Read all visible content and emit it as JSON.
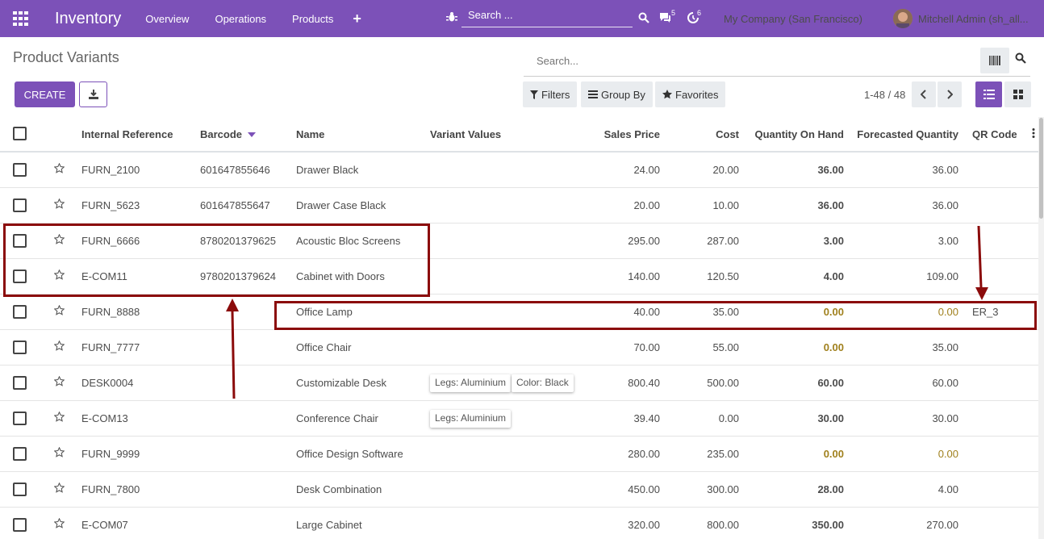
{
  "navbar": {
    "app_title": "Inventory",
    "menu": [
      "Overview",
      "Operations",
      "Products"
    ],
    "plus": "+",
    "search_placeholder": "Search ...",
    "chat_count": "5",
    "activity_count": "6",
    "company": "My Company (San Francisco)",
    "user": "Mitchell Admin (sh_all..."
  },
  "control": {
    "breadcrumb": "Product Variants",
    "search_placeholder": "Search...",
    "create": "CREATE",
    "filters": "Filters",
    "group_by": "Group By",
    "favorites": "Favorites",
    "pager": "1-48 / 48"
  },
  "table": {
    "headers": {
      "internal_ref": "Internal Reference",
      "barcode": "Barcode",
      "name": "Name",
      "variant_values": "Variant Values",
      "sales_price": "Sales Price",
      "cost": "Cost",
      "qty_on_hand": "Quantity On Hand",
      "forecasted": "Forecasted Quantity",
      "qr_code": "QR Code"
    },
    "rows": [
      {
        "ref": "FURN_2100",
        "barcode": "601647855646",
        "name": "Drawer Black",
        "price": "24.00",
        "cost": "20.00",
        "qty": "36.00",
        "forecast": "36.00",
        "qr": ""
      },
      {
        "ref": "FURN_5623",
        "barcode": "601647855647",
        "name": "Drawer Case Black",
        "price": "20.00",
        "cost": "10.00",
        "qty": "36.00",
        "forecast": "36.00",
        "qr": ""
      },
      {
        "ref": "FURN_6666",
        "barcode": "8780201379625",
        "name": "Acoustic Bloc Screens",
        "price": "295.00",
        "cost": "287.00",
        "qty": "3.00",
        "forecast": "3.00",
        "qr": ""
      },
      {
        "ref": "E-COM11",
        "barcode": "9780201379624",
        "name": "Cabinet with Doors",
        "price": "140.00",
        "cost": "120.50",
        "qty": "4.00",
        "forecast": "109.00",
        "qr": ""
      },
      {
        "ref": "FURN_8888",
        "barcode": "",
        "name": "Office Lamp",
        "price": "40.00",
        "cost": "35.00",
        "qty": "0.00",
        "forecast": "0.00",
        "qr": "ER_3"
      },
      {
        "ref": "FURN_7777",
        "barcode": "",
        "name": "Office Chair",
        "price": "70.00",
        "cost": "55.00",
        "qty": "0.00",
        "forecast": "35.00",
        "qr": ""
      },
      {
        "ref": "DESK0004",
        "barcode": "",
        "name": "Customizable Desk",
        "tags": [
          "Legs: Aluminium",
          "Color: Black"
        ],
        "price": "800.40",
        "cost": "500.00",
        "qty": "60.00",
        "forecast": "60.00",
        "qr": ""
      },
      {
        "ref": "E-COM13",
        "barcode": "",
        "name": "Conference Chair",
        "tags": [
          "Legs: Aluminium"
        ],
        "price": "39.40",
        "cost": "0.00",
        "qty": "30.00",
        "forecast": "30.00",
        "qr": ""
      },
      {
        "ref": "FURN_9999",
        "barcode": "",
        "name": "Office Design Software",
        "price": "280.00",
        "cost": "235.00",
        "qty": "0.00",
        "forecast": "0.00",
        "qr": ""
      },
      {
        "ref": "FURN_7800",
        "barcode": "",
        "name": "Desk Combination",
        "price": "450.00",
        "cost": "300.00",
        "qty": "28.00",
        "forecast": "4.00",
        "qr": ""
      },
      {
        "ref": "E-COM07",
        "barcode": "",
        "name": "Large Cabinet",
        "price": "320.00",
        "cost": "800.00",
        "qty": "350.00",
        "forecast": "270.00",
        "qr": ""
      }
    ]
  },
  "colors": {
    "brand": "#7c51b8",
    "annotation": "#8b0b0b",
    "zero_qty": "#a0801d"
  }
}
